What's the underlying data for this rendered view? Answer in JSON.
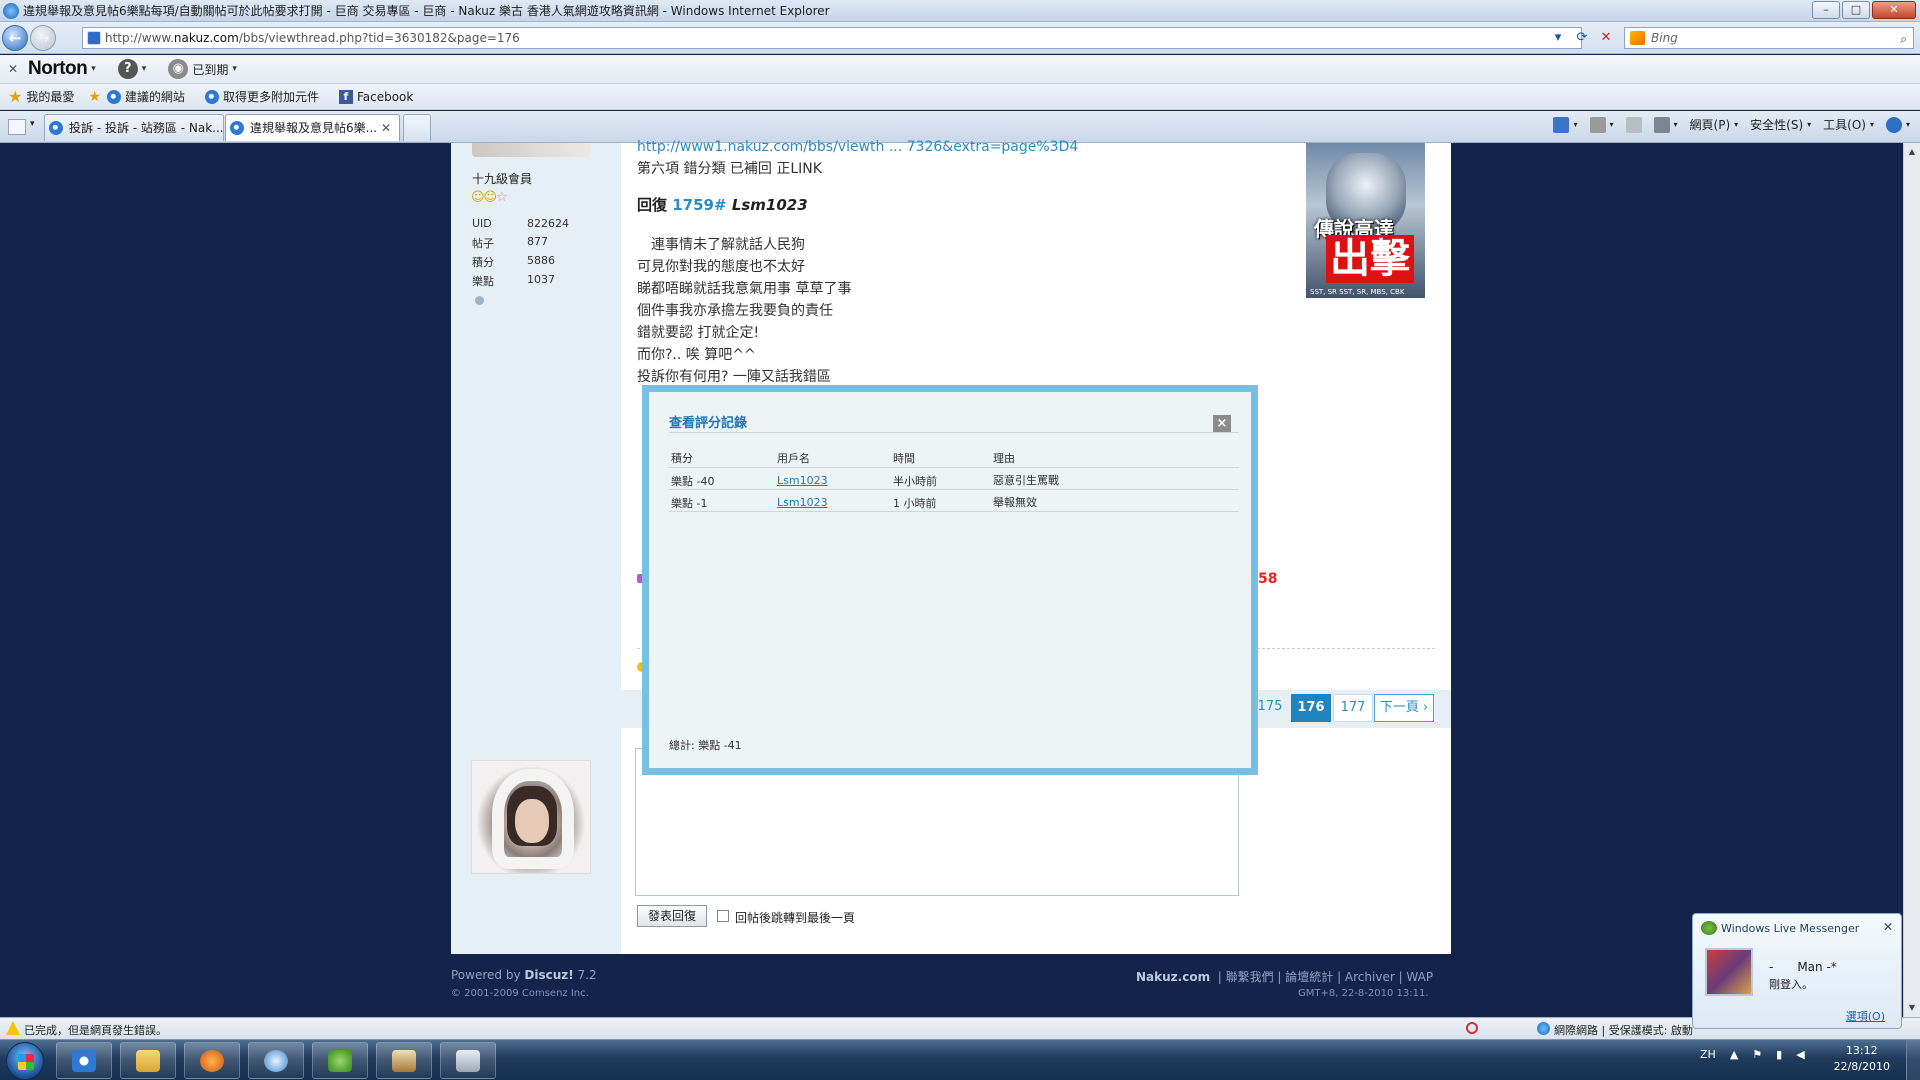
{
  "window": {
    "title": "違規舉報及意見帖6樂點每項/自動關帖可於此帖要求打開 - 巨商 交易專區 - 巨商 - Nakuz 樂古 香港人氣網遊攻略資訊網 - Windows Internet Explorer",
    "btn_min": "–",
    "btn_max": "□",
    "btn_close": "✕"
  },
  "address": {
    "prefix": "http://www.",
    "host": "nakuz.com",
    "path": "/bbs/viewthread.php?tid=3630182&page=176",
    "search_placeholder": "Bing"
  },
  "norton": {
    "brand": "Norton",
    "help": "?",
    "status": "已到期"
  },
  "favorites": {
    "fav_label": "我的最愛",
    "items": [
      "建議的網站",
      "取得更多附加元件",
      "Facebook"
    ]
  },
  "tabs": [
    {
      "label": "投訴 - 投訴 - 站務區 - Nak..."
    },
    {
      "label": "違規舉報及意見帖6樂..."
    }
  ],
  "commandbar": {
    "page": "網頁(P)",
    "safety": "安全性(S)",
    "tools": "工具(O)"
  },
  "user": {
    "rank": "十九級會員",
    "stats": [
      {
        "label": "UID",
        "value": "822624"
      },
      {
        "label": "帖子",
        "value": "877"
      },
      {
        "label": "積分",
        "value": "5886"
      },
      {
        "label": "樂點",
        "value": "1037"
      }
    ]
  },
  "post": {
    "link": "http://www1.nakuz.com/bbs/viewth ... 7326&extra=page%3D4",
    "line_after_link": "第六項 錯分類 已補回 正LINK",
    "reply_prefix": "回復",
    "reply_num": "1759#",
    "reply_user": "Lsm1023",
    "lines": [
      "　連事情未了解就話人民狗",
      "可見你對我的態度也不太好",
      "睇都唔睇就話我意氣用事 草草了事",
      "個件事我亦承擔左我要負的責任",
      "錯就要認 打就企定!",
      "而你?.. 唉 算吧^^",
      "投訴你有何用? 一陣又話我錯區"
    ],
    "red_fragment": "58"
  },
  "ad": {
    "title": "傳說高達",
    "big": "出擊",
    "footer": "SST, SR SST, SR, MBS, CBK"
  },
  "pagination": {
    "pages": [
      "175",
      "176",
      "177"
    ],
    "current": "176",
    "next": "下一頁 ›"
  },
  "reply_form": {
    "submit": "發表回復",
    "jump_label": "回帖後跳轉到最後一頁"
  },
  "footer": {
    "powered_prefix": "Powered by ",
    "powered_brand": "Discuz!",
    "powered_version": " 7.2",
    "copyright": "© 2001-2009 Comsenz Inc.",
    "site": "Nakuz.com",
    "links": "| 聯繫我們 | 論壇統計 | Archiver | WAP",
    "time": "GMT+8, 22-8-2010 13:11."
  },
  "rating_dialog": {
    "title": "查看評分記錄",
    "close": "×",
    "headers": [
      "積分",
      "用戶名",
      "時間",
      "理由"
    ],
    "rows": [
      {
        "score": "樂點 -40",
        "user": "Lsm1023",
        "time": "半小時前",
        "reason": "惡意引生罵戰"
      },
      {
        "score": "樂點 -1",
        "user": "Lsm1023",
        "time": "1 小時前",
        "reason": "舉報無效"
      }
    ],
    "total": "總計: 樂點 -41"
  },
  "statusbar": {
    "text": "已完成，但是網頁發生錯誤。",
    "zone": "網際網路 | 受保護模式: 啟動"
  },
  "messenger": {
    "title": "Windows Live Messenger",
    "name": "-　　Man -*",
    "status": "剛登入。",
    "options": "選項(O)"
  },
  "taskbar": {
    "lang": "ZH",
    "time": "13:12",
    "date": "22/8/2010"
  }
}
